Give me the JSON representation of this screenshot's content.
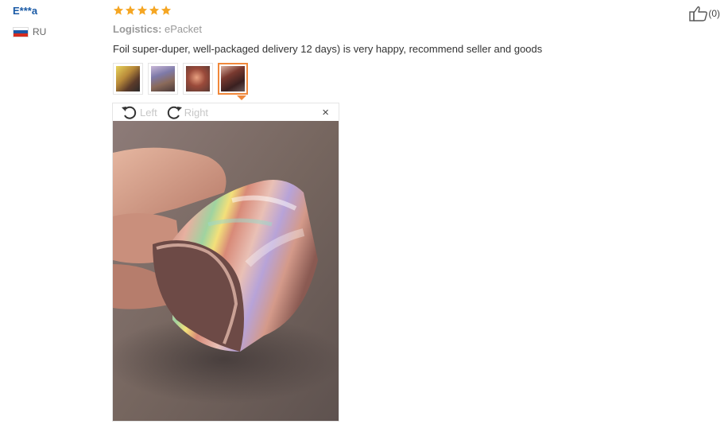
{
  "reviewer": {
    "name": "E***a",
    "country_code": "RU"
  },
  "rating": {
    "stars": 5,
    "max": 5,
    "color": "#f5a623"
  },
  "logistics": {
    "label": "Logistics:",
    "value": "ePacket"
  },
  "review_text": "Foil super-duper, well-packaged delivery 12 days) is very happy, recommend seller and goods",
  "thumbnails": [
    {
      "name": "photo-1",
      "active": false
    },
    {
      "name": "photo-2",
      "active": false
    },
    {
      "name": "photo-3",
      "active": false
    },
    {
      "name": "photo-4",
      "active": true
    }
  ],
  "viewer": {
    "rotate_left_label": "Left",
    "rotate_right_label": "Right",
    "close_symbol": "×",
    "accent_color": "#f0883b"
  },
  "helpful": {
    "count_label": "(0)",
    "icon": "thumbs-up-icon"
  }
}
